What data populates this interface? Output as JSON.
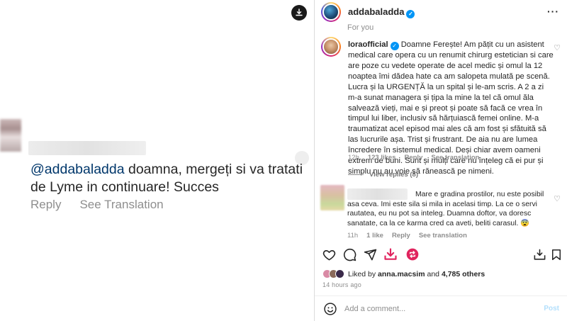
{
  "left": {
    "mention": "@addabaladda",
    "text_line1": " doamna, mergeți si va tratati",
    "text_line2": "de Lyme in continuare! Succes",
    "reply": "Reply",
    "see_translation": "See Translation"
  },
  "post": {
    "username": "addabaladda",
    "for_you": "For you",
    "comments": [
      {
        "username": "loraofficial",
        "text": "Doamne Ferește! Am pățit cu un asistent medical care opera cu un renumit chirurg estetician si care are poze cu vedete operate de acel medic și omul la 12 noaptea îmi dădea hate ca am salopeta mulată pe scenă. Lucra și la URGENȚĂ la un spital și le-am scris. A 2 a zi m-a sunat managera și țipa la mine la tel că omul ăla salvează vieți, mai e și preot și poate să facă ce vrea în timpul lui liber, inclusiv să hărțuiască femei online. M-a traumatizat acel episod mai ales că am fost și sfătuită să las lucrurile așa. Trist și frustrant. De aia nu are lumea încredere în sistemul medical. Deși chiar avem oameni extrem de buni. Sunt și mulți care nu înțeleg că ei pur și simplu nu au voie să rănească pe nimeni.",
        "time": "12h",
        "likes": "123 likes",
        "reply": "Reply",
        "see_translation": "See translation",
        "view_replies": "View replies (8)"
      },
      {
        "text": "Mare e gradina prostilor, nu este posibil asa ceva. Imi este sila si mila in acelasi timp. La ce o servi rautatea, eu nu pot sa inteleg. Duamna doftor, va doresc sanatate, ca la ce karma cred ca aveti, beliti carasul. 😨",
        "time": "11h",
        "likes": "1 like",
        "reply": "Reply",
        "see_translation": "See translation"
      }
    ],
    "liked_by_prefix": "Liked by ",
    "liked_by_user": "anna.macsim",
    "liked_by_and": " and ",
    "liked_by_others": "4,785 others",
    "time_ago": "14 hours ago",
    "add_comment_placeholder": "Add a comment...",
    "post_label": "Post"
  },
  "colors": {
    "accent": "#0095f6",
    "mention": "#00376b",
    "download_red": "#e0245e"
  }
}
